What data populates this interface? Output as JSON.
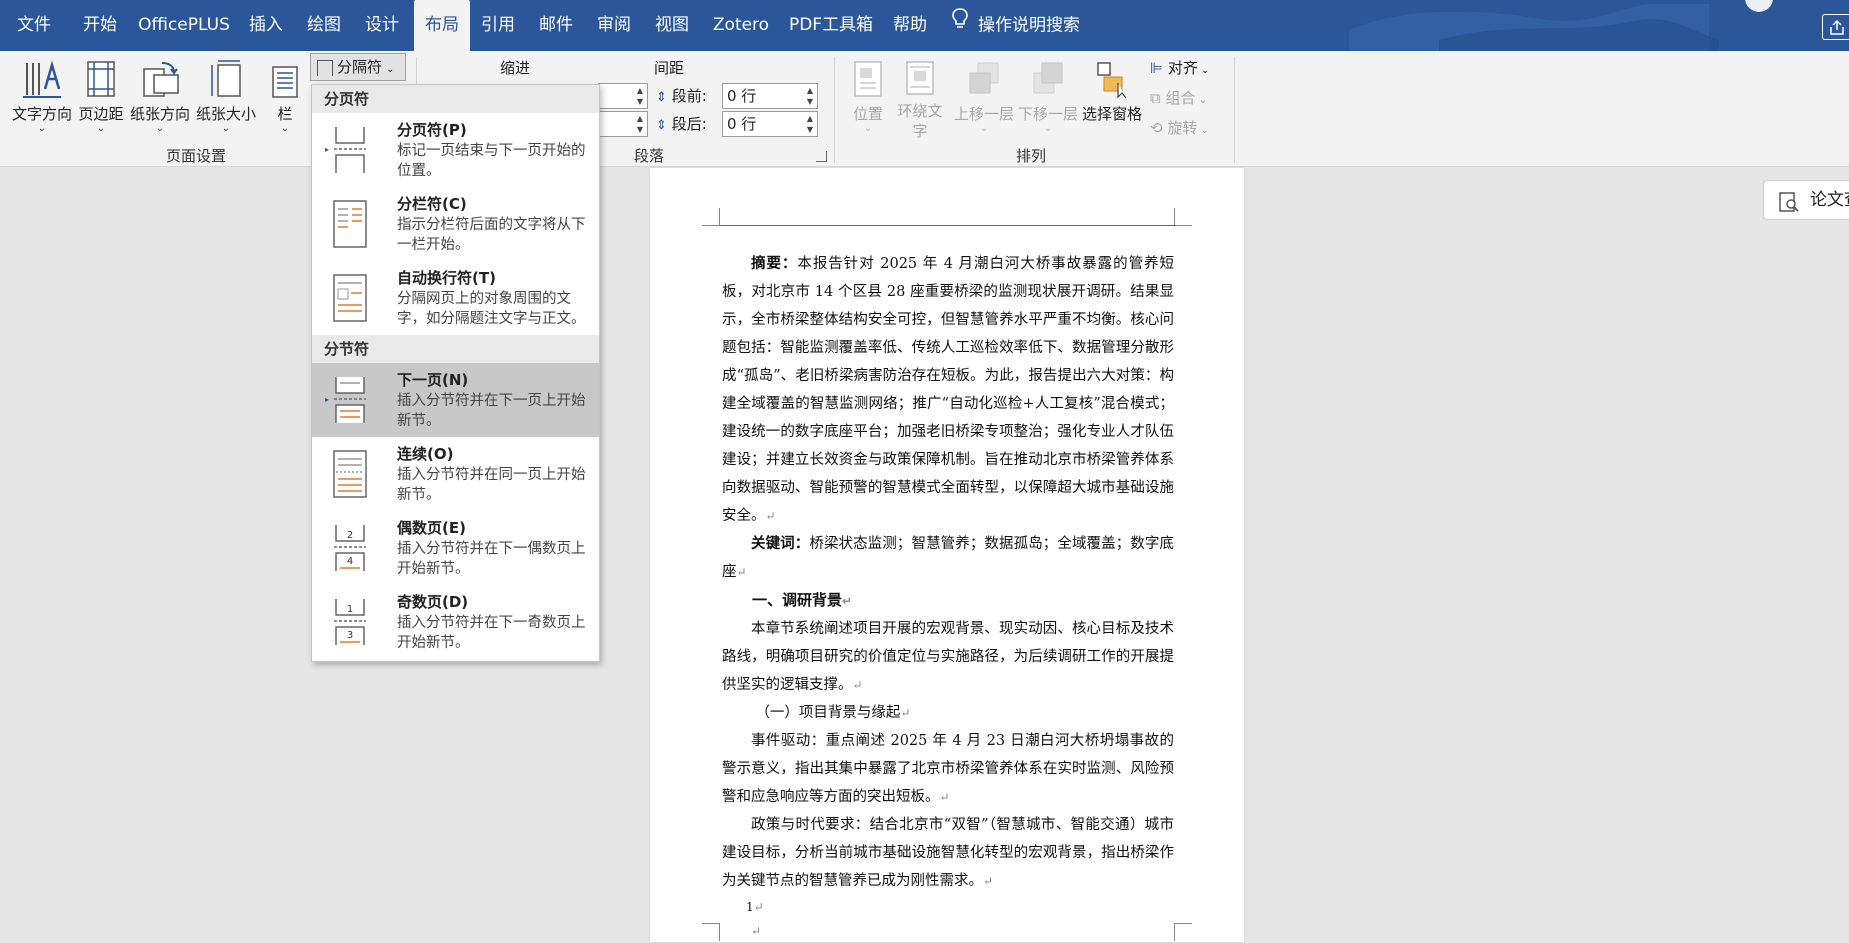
{
  "menubar": {
    "tabs": [
      {
        "label": "文件"
      },
      {
        "label": "开始"
      },
      {
        "label": "OfficePLUS"
      },
      {
        "label": "插入"
      },
      {
        "label": "绘图"
      },
      {
        "label": "设计"
      },
      {
        "label": "布局"
      },
      {
        "label": "引用"
      },
      {
        "label": "邮件"
      },
      {
        "label": "审阅"
      },
      {
        "label": "视图"
      },
      {
        "label": "Zotero"
      },
      {
        "label": "PDF工具箱"
      },
      {
        "label": "帮助"
      }
    ],
    "active_tab": "布局",
    "search_label": "操作说明搜索"
  },
  "ribbon": {
    "page_setup": {
      "text_direction": "文字方向",
      "margins": "页边距",
      "orientation": "纸张方向",
      "size": "纸张大小",
      "columns": "栏",
      "breaks": "分隔符",
      "group_label": "页面设置"
    },
    "paragraph": {
      "indent_label": "缩进",
      "spacing_label": "间距",
      "before_label": "段前:",
      "before_value": "0 行",
      "after_label": "段后:",
      "after_value": "0 行",
      "group_label": "段落"
    },
    "arrange": {
      "position": "位置",
      "wrap_text": "环绕文字",
      "bring_forward": "上移一层",
      "send_backward": "下移一层",
      "selection_pane": "选择窗格",
      "align": "对齐",
      "group": "组合",
      "rotate": "旋转",
      "group_label": "排列"
    }
  },
  "breaks_menu": {
    "page_breaks_header": "分页符",
    "section_breaks_header": "分节符",
    "items": [
      {
        "title": "分页符(P)",
        "desc": "标记一页结束与下一页开始的位置。"
      },
      {
        "title": "分栏符(C)",
        "desc": "指示分栏符后面的文字将从下一栏开始。"
      },
      {
        "title": "自动换行符(T)",
        "desc": "分隔网页上的对象周围的文字，如分隔题注文字与正文。"
      },
      {
        "title": "下一页(N)",
        "desc": "插入分节符并在下一页上开始新节。"
      },
      {
        "title": "连续(O)",
        "desc": "插入分节符并在同一页上开始新节。"
      },
      {
        "title": "偶数页(E)",
        "desc": "插入分节符并在下一偶数页上开始新节。"
      },
      {
        "title": "奇数页(D)",
        "desc": "插入分节符并在下一奇数页上开始新节。"
      }
    ],
    "selected": "下一页(N)"
  },
  "side_panel": {
    "label": "论文查"
  },
  "document": {
    "abstract_label": "摘要：",
    "abstract_text": "本报告针对 2025 年 4 月潮白河大桥事故暴露的管养短板，对北京市 14 个区县 28 座重要桥梁的监测现状展开调研。结果显示，全市桥梁整体结构安全可控，但智慧管养水平严重不均衡。核心问题包括：智能监测覆盖率低、传统人工巡检效率低下、数据管理分散形成“孤岛”、老旧桥梁病害防治存在短板。为此，报告提出六大对策：构建全域覆盖的智慧监测网络；推广“自动化巡检+人工复核”混合模式；建设统一的数字底座平台；加强老旧桥梁专项整治；强化专业人才队伍建设；并建立长效资金与政策保障机制。旨在推动北京市桥梁管养体系向数据驱动、智能预警的智慧模式全面转型，以保障超大城市基础设施安全。",
    "keywords_label": "关键词：",
    "keywords_text": "桥梁状态监测；智慧管养；数据孤岛；全域覆盖；数字底座",
    "heading1": "一、调研背景",
    "para1": "本章节系统阐述项目开展的宏观背景、现实动因、核心目标及技术路线，明确项目研究的价值定位与实施路径，为后续调研工作的开展提供坚实的逻辑支撑。",
    "subheading1": "（一）项目背景与缘起",
    "para2": "事件驱动：重点阐述 2025 年 4 月 23 日潮白河大桥坍塌事故的警示意义，指出其集中暴露了北京市桥梁管养体系在实时监测、风险预警和应急响应等方面的突出短板。",
    "para3": "政策与时代要求：结合北京市“双智”（智慧城市、智能交通）城市建设目标，分析当前城市基础设施智慧化转型的宏观背景，指出桥梁作为关键节点的智慧管养已成为刚性需求。",
    "footnote_num": "1"
  }
}
